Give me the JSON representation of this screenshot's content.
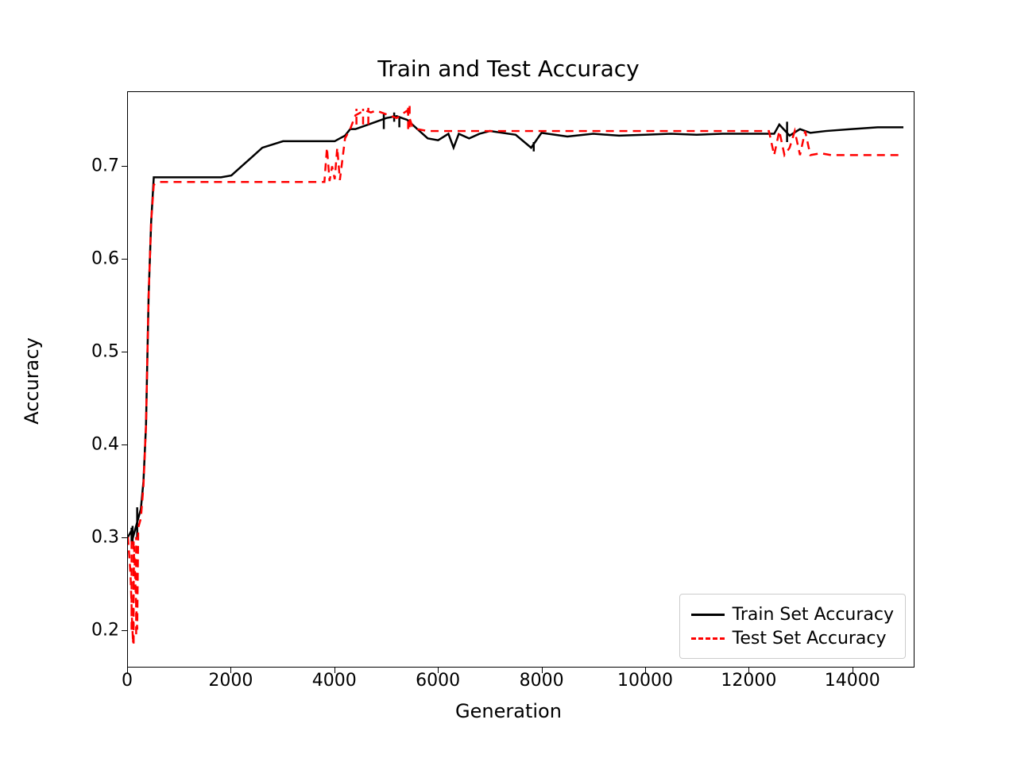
{
  "chart_data": {
    "type": "line",
    "title": "Train and Test Accuracy",
    "xlabel": "Generation",
    "ylabel": "Accuracy",
    "xlim": [
      0,
      15200
    ],
    "ylim": [
      0.16,
      0.78
    ],
    "xticks": [
      0,
      2000,
      4000,
      6000,
      8000,
      10000,
      12000,
      14000
    ],
    "yticks": [
      0.2,
      0.3,
      0.4,
      0.5,
      0.6,
      0.7
    ],
    "legend_position": "lower right",
    "series": [
      {
        "name": "Train Set Accuracy",
        "color": "#000000",
        "style": "solid",
        "x": [
          0,
          50,
          100,
          150,
          200,
          250,
          300,
          350,
          400,
          450,
          500,
          600,
          800,
          1200,
          1800,
          2000,
          2200,
          2400,
          2600,
          3000,
          3500,
          3900,
          4000,
          4100,
          4200,
          4300,
          4400,
          4600,
          4800,
          5000,
          5200,
          5400,
          5600,
          5800,
          6000,
          6200,
          6300,
          6400,
          6600,
          6800,
          7000,
          7500,
          7800,
          8000,
          8500,
          9000,
          9500,
          10000,
          10500,
          11000,
          11500,
          12000,
          12500,
          12600,
          12800,
          13000,
          13200,
          13500,
          14000,
          14500,
          15000
        ],
        "y": [
          0.3,
          0.305,
          0.3,
          0.31,
          0.32,
          0.33,
          0.36,
          0.42,
          0.56,
          0.64,
          0.688,
          0.688,
          0.688,
          0.688,
          0.688,
          0.69,
          0.7,
          0.71,
          0.72,
          0.727,
          0.727,
          0.727,
          0.727,
          0.73,
          0.733,
          0.74,
          0.74,
          0.744,
          0.748,
          0.752,
          0.754,
          0.75,
          0.74,
          0.73,
          0.728,
          0.735,
          0.72,
          0.735,
          0.73,
          0.735,
          0.738,
          0.734,
          0.72,
          0.736,
          0.732,
          0.735,
          0.733,
          0.734,
          0.735,
          0.734,
          0.735,
          0.735,
          0.735,
          0.745,
          0.733,
          0.74,
          0.736,
          0.738,
          0.74,
          0.742,
          0.742
        ],
        "x_spikes": [
          70,
          90,
          180,
          4950,
          5150,
          5250,
          7850,
          12750
        ],
        "y_spikes_low": [
          0.295,
          0.292,
          0.3,
          0.74,
          0.748,
          0.742,
          0.716,
          0.726
        ],
        "y_spikes_high": [
          0.31,
          0.312,
          0.332,
          0.756,
          0.758,
          0.752,
          0.726,
          0.748
        ]
      },
      {
        "name": "Test Set Accuracy",
        "color": "#ff0000",
        "style": "dashed",
        "x": [
          0,
          50,
          80,
          100,
          120,
          150,
          180,
          200,
          250,
          300,
          350,
          400,
          450,
          500,
          600,
          800,
          1200,
          2000,
          3000,
          3800,
          3850,
          3900,
          3950,
          4000,
          4050,
          4100,
          4200,
          4300,
          4400,
          4500,
          4600,
          4700,
          4800,
          5000,
          5200,
          5400,
          5500,
          5600,
          5800,
          6000,
          7000,
          8000,
          9000,
          10000,
          11000,
          12000,
          12400,
          12500,
          12600,
          12700,
          12800,
          12900,
          13000,
          13100,
          13200,
          13400,
          13600,
          14000,
          14500,
          15000
        ],
        "y": [
          0.3,
          0.26,
          0.21,
          0.185,
          0.29,
          0.24,
          0.2,
          0.31,
          0.32,
          0.355,
          0.42,
          0.56,
          0.64,
          0.68,
          0.683,
          0.683,
          0.683,
          0.683,
          0.683,
          0.683,
          0.72,
          0.684,
          0.7,
          0.686,
          0.72,
          0.685,
          0.73,
          0.74,
          0.755,
          0.758,
          0.76,
          0.758,
          0.76,
          0.756,
          0.752,
          0.76,
          0.743,
          0.74,
          0.738,
          0.738,
          0.738,
          0.738,
          0.738,
          0.738,
          0.738,
          0.738,
          0.738,
          0.712,
          0.738,
          0.712,
          0.72,
          0.738,
          0.712,
          0.738,
          0.712,
          0.714,
          0.712,
          0.712,
          0.712,
          0.712
        ],
        "x_spikes": [
          70,
          110,
          160,
          4420,
          4550,
          4650,
          5420,
          5450
        ],
        "y_spikes_low": [
          0.2,
          0.185,
          0.195,
          0.745,
          0.745,
          0.745,
          0.74,
          0.742
        ],
        "y_spikes_high": [
          0.3,
          0.3,
          0.3,
          0.762,
          0.762,
          0.763,
          0.765,
          0.765
        ]
      }
    ]
  }
}
